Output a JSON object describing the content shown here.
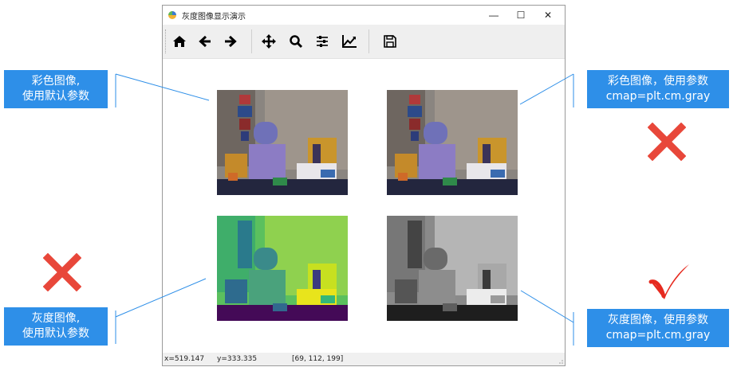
{
  "window": {
    "title": "灰度图像显示演示",
    "controls": {
      "minimize": "—",
      "maximize": "☐",
      "close": "✕"
    }
  },
  "toolbar": {
    "buttons": [
      "home-icon",
      "back-arrow-icon",
      "forward-arrow-icon",
      "pan-icon",
      "zoom-icon",
      "configure-subplots-icon",
      "edit-axes-icon",
      "save-icon"
    ]
  },
  "status": {
    "x": "x=519.147",
    "y": "y=333.335",
    "pixel": "[69, 112, 199]"
  },
  "callouts": {
    "top_left": {
      "line1": "彩色图像,",
      "line2": "使用默认参数"
    },
    "top_right": {
      "line1": "彩色图像，使用参数",
      "line2": "cmap=plt.cm.gray"
    },
    "bottom_left": {
      "line1": "灰度图像,",
      "line2": "使用默认参数"
    },
    "bottom_right": {
      "line1": "灰度图像，使用参数",
      "line2": "cmap=plt.cm.gray"
    }
  },
  "marks": {
    "top_right": "cross",
    "bottom_left": "cross",
    "bottom_right": "check"
  },
  "colors": {
    "callout": "#2e8fe8",
    "cross": "#e8473a",
    "check": "#e62a1f"
  }
}
